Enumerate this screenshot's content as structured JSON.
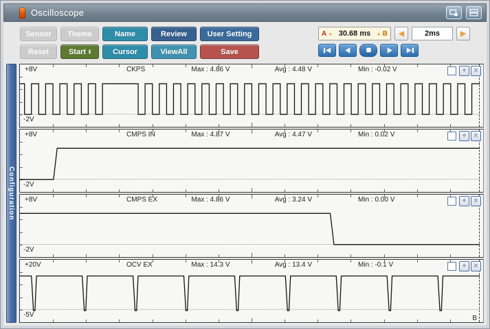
{
  "titlebar": {
    "title": "Oscilloscope",
    "icon": "app-icon",
    "buttons": [
      {
        "icon": "switch-window-icon"
      },
      {
        "icon": "stacked-windows-icon"
      }
    ]
  },
  "toolbar": {
    "rows": [
      {
        "buttons": [
          {
            "label": "Sensor",
            "color": "#cccccc",
            "enabled": false
          },
          {
            "label": "Theme",
            "color": "#cccccc",
            "enabled": false
          },
          {
            "label": "Name",
            "color": "#2e8da9",
            "enabled": true
          },
          {
            "label": "Review",
            "color": "#35608f",
            "enabled": true
          },
          {
            "label": "User Setting",
            "color": "#3a6b9c",
            "enabled": true
          }
        ]
      },
      {
        "buttons": [
          {
            "label": "Reset",
            "color": "#cccccc",
            "enabled": false
          },
          {
            "label": "Start",
            "color": "#5c7b31",
            "enabled": true,
            "spinner": true
          },
          {
            "label": "Cursor",
            "color": "#2e8da9",
            "enabled": true
          },
          {
            "label": "ViewAll",
            "color": "#3f93af",
            "enabled": true
          },
          {
            "label": "Save",
            "color": "#b5534c",
            "enabled": true
          }
        ]
      }
    ]
  },
  "time_readout": {
    "a_label": "A",
    "left_arrow": "left-arrow-icon",
    "value": "30.68 ms",
    "right_arrow": "right-arrow-icon",
    "b_label": "B"
  },
  "timebase": {
    "value": "2ms",
    "prev_icon": "left-arrow-icon",
    "next_icon": "right-arrow-icon"
  },
  "playback": {
    "buttons": [
      "skip-start",
      "step-back",
      "stop",
      "step-forward",
      "skip-end"
    ],
    "color": "#3c7ab8"
  },
  "sidebar": {
    "label": "Configuration",
    "color": "#4a6fa5"
  },
  "channel_controls": {
    "zoom_label": "+",
    "close_label": "×"
  },
  "channels": [
    {
      "name": "CKPS",
      "top_label": "+8V",
      "bottom_label": "-2V",
      "max": "Max : 4.86 V",
      "avg": "Avg : 4.48 V",
      "min": "Min : -0.02 V",
      "corner_label": "",
      "waveform": {
        "type": "pulse_train",
        "high_pct": 31,
        "low_pct": 80,
        "start_pct": 1.0,
        "period_pct": 3.09,
        "low_width_pct": 1.5,
        "gaps": [
          [
            17.2,
            25.2
          ]
        ]
      }
    },
    {
      "name": "CMPS IN",
      "top_label": "+8V",
      "bottom_label": "-2V",
      "max": "Max : 4.87 V",
      "avg": "Avg : 4.47 V",
      "min": "Min : 0.02 V",
      "corner_label": "",
      "waveform": {
        "type": "step_up",
        "low_pct": 80,
        "high_pct": 30,
        "step_pct": 7.3
      }
    },
    {
      "name": "CMPS EX",
      "top_label": "+8V",
      "bottom_label": "-2V",
      "max": "Max : 4.86 V",
      "avg": "Avg : 3.24 V",
      "min": "Min : 0.00 V",
      "corner_label": "",
      "waveform": {
        "type": "step_down",
        "high_pct": 30,
        "low_pct": 80,
        "step_pct": 67.5
      }
    },
    {
      "name": "OCV EX",
      "top_label": "+20V",
      "bottom_label": "-5V",
      "max": "Max : 14.3 V",
      "avg": "Avg : 13.4 V",
      "min": "Min : -0.1 V",
      "corner_label": "B",
      "waveform": {
        "type": "spike_train",
        "high_pct": 26,
        "low_pct": 81.5,
        "start_pct": 2.5,
        "period_pct": 11.05,
        "count": 9,
        "spike_width_pct": 1.1
      }
    }
  ]
}
